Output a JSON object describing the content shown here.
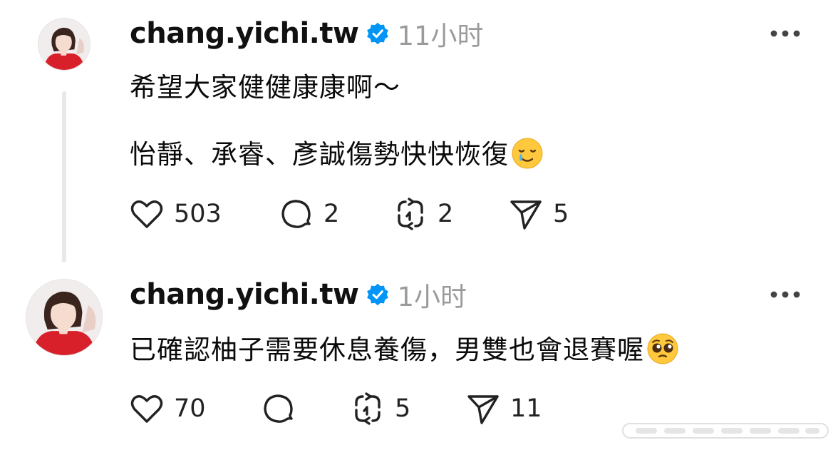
{
  "posts": [
    {
      "username": "chang.yichi.tw",
      "timestamp": "11小时",
      "lines": [
        "希望大家健健康康啊～",
        "怡靜、承睿、彥誠傷勢快快恢復"
      ],
      "actions": {
        "likes": "503",
        "comments": "2",
        "reposts": "2",
        "shares": "5"
      }
    },
    {
      "username": "chang.yichi.tw",
      "timestamp": "1小时",
      "lines": [
        "已確認柚子需要休息養傷，男雙也會退賽喔"
      ],
      "actions": {
        "likes": "70",
        "comments": "",
        "reposts": "5",
        "shares": "11"
      }
    }
  ],
  "icons": {
    "verified": "verified-badge-icon",
    "more": "more-options-icon",
    "like": "heart-icon",
    "comment": "comment-icon",
    "repost": "repost-icon",
    "share": "send-icon",
    "emoji_1": "smiling-face-with-tear-emoji",
    "emoji_2": "pleading-face-emoji"
  },
  "colors": {
    "verified": "#0095f6",
    "timestamp": "#9b9b9b",
    "thread_line": "#e8e8e8",
    "avatar_shirt": "#d8202a"
  }
}
